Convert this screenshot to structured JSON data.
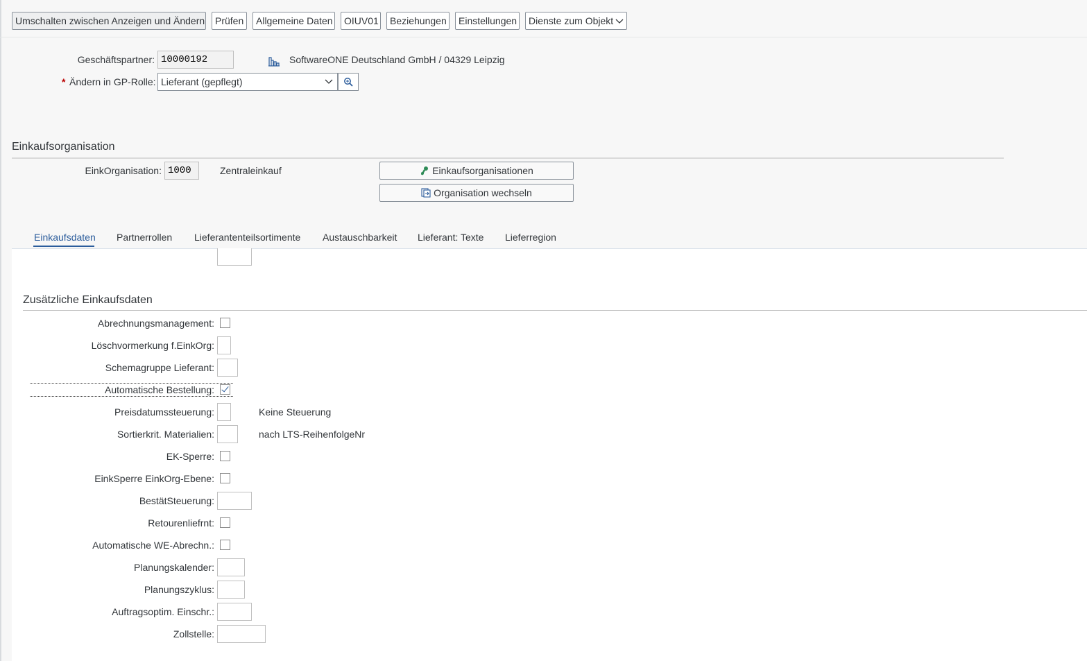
{
  "toolbar": {
    "buttons": [
      "Umschalten zwischen Anzeigen und Ändern",
      "Prüfen",
      "Allgemeine Daten",
      "OIUV01",
      "Beziehungen",
      "Einstellungen",
      "Dienste zum Objekt"
    ]
  },
  "header": {
    "partner_label": "Geschäftspartner:",
    "partner_value": "10000192",
    "partner_desc": "SoftwareONE Deutschland GmbH / 04329 Leipzig",
    "required_mark": "*",
    "role_label": "Ändern in GP-Rolle:",
    "role_value": "Lieferant (gepflegt)"
  },
  "org": {
    "section_title": "Einkaufsorganisation",
    "eink_label": "EinkOrganisation:",
    "eink_value": "1000",
    "eink_desc": "Zentraleinkauf",
    "btn_orgs": "Einkaufsorganisationen",
    "btn_switch": "Organisation wechseln"
  },
  "tabs": [
    "Einkaufsdaten",
    "Partnerrollen",
    "Lieferantenteilsortimente",
    "Austauschbarkeit",
    "Lieferant: Texte",
    "Lieferregion"
  ],
  "additional": {
    "title": "Zusätzliche Einkaufsdaten",
    "rows": [
      {
        "label": "Abrechnungsmanagement:"
      },
      {
        "label": "Löschvormerkung f.EinkOrg:"
      },
      {
        "label": "Schemagruppe Lieferant:"
      },
      {
        "label": "Automatische Bestellung:",
        "checked": true
      },
      {
        "label": "Preisdatumssteuerung:",
        "desc": "Keine Steuerung"
      },
      {
        "label": "Sortierkrit. Materialien:",
        "desc": "nach LTS-ReihenfolgeNr"
      },
      {
        "label": "EK-Sperre:"
      },
      {
        "label": "EinkSperre EinkOrg-Ebene:"
      },
      {
        "label": "BestätSteuerung:"
      },
      {
        "label": "Retourenliefrnt:"
      },
      {
        "label": "Automatische WE-Abrechn.:"
      },
      {
        "label": "Planungskalender:"
      },
      {
        "label": "Planungszyklus:"
      },
      {
        "label": "Auftragsoptim. Einschr.:"
      },
      {
        "label": "Zollstelle:"
      }
    ]
  }
}
